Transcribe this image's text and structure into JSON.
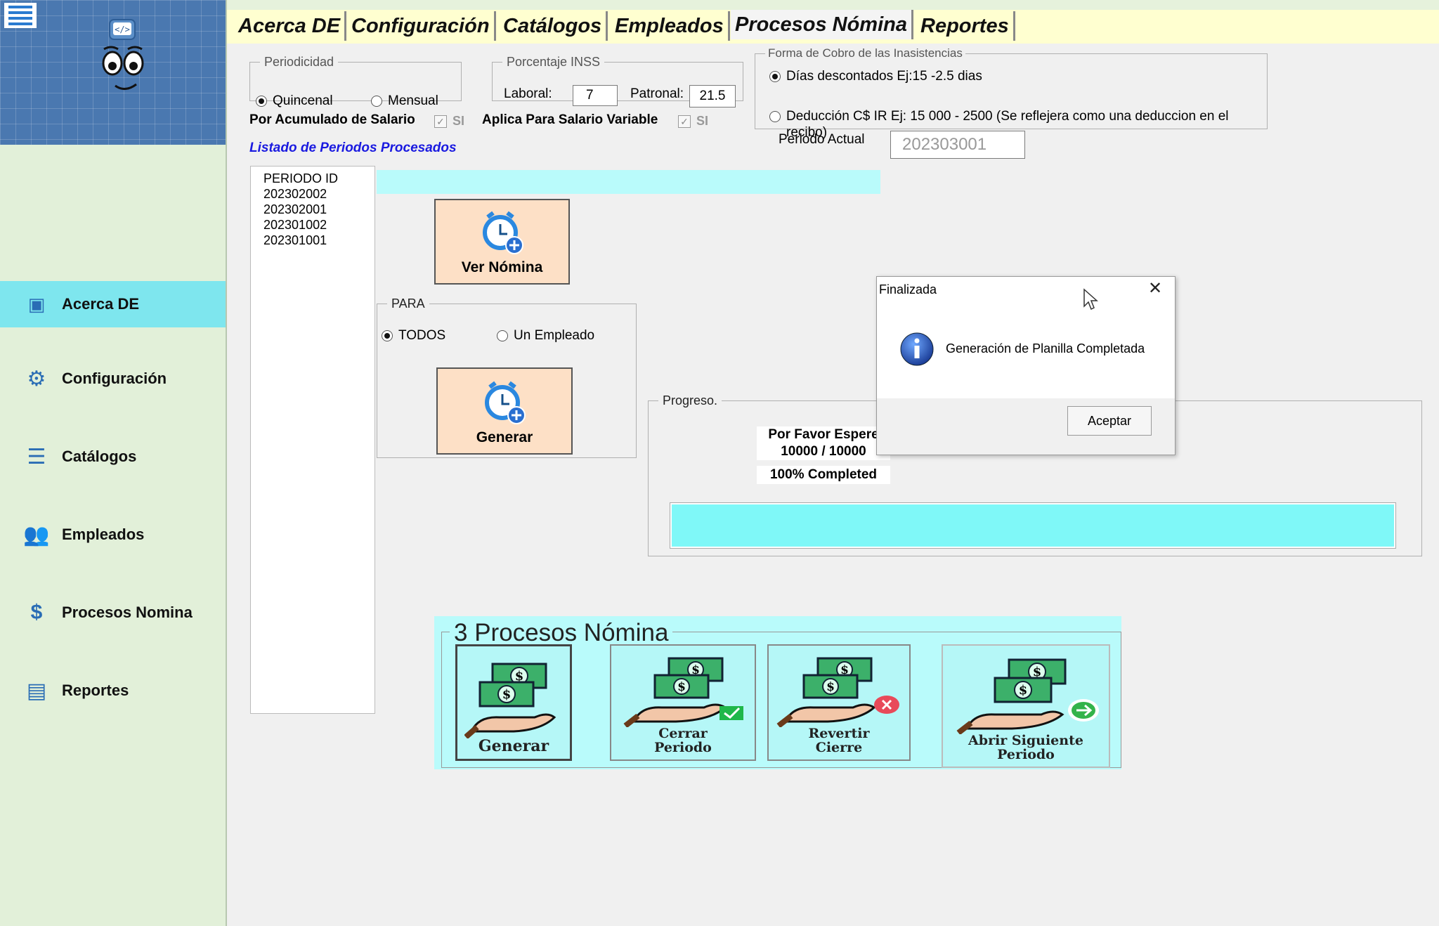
{
  "sidebar": {
    "items": [
      {
        "label": "Acerca DE",
        "icon": "about-icon",
        "active": true
      },
      {
        "label": "Configuración",
        "icon": "gear-icon",
        "active": false
      },
      {
        "label": "Catálogos",
        "icon": "catalog-icon",
        "active": false
      },
      {
        "label": "Empleados",
        "icon": "employees-icon",
        "active": false
      },
      {
        "label": "Procesos Nomina",
        "icon": "payroll-icon",
        "active": false
      },
      {
        "label": "Reportes",
        "icon": "reports-icon",
        "active": false
      }
    ]
  },
  "tabs": [
    {
      "label": "Acerca DE",
      "active": false
    },
    {
      "label": "Configuración",
      "active": false
    },
    {
      "label": "Catálogos",
      "active": false
    },
    {
      "label": "Empleados",
      "active": false
    },
    {
      "label": "Procesos Nómina",
      "active": true
    },
    {
      "label": "Reportes",
      "active": false
    }
  ],
  "periodicidad": {
    "legend": "Periodicidad",
    "options": [
      {
        "label": "Quincenal",
        "selected": true
      },
      {
        "label": "Mensual",
        "selected": false
      }
    ]
  },
  "inss": {
    "legend": "Porcentaje INSS",
    "laboral_label": "Laboral:",
    "laboral_value": "7",
    "patronal_label": "Patronal:",
    "patronal_value": "21.5"
  },
  "forma_cobro": {
    "legend": "Forma de Cobro de las Inasistencias",
    "option1": "Días descontados  Ej:15 -2.5 dias",
    "option1_selected": true,
    "option2": "Deducción C$ IR Ej: 15 000 - 2500 (Se reflejera como una deduccion en el recibo)",
    "option2_selected": false
  },
  "acumulado": {
    "label": "Por Acumulado de Salario",
    "check_label": "SI",
    "checked": true
  },
  "salario_variable": {
    "label": "Aplica Para Salario Variable",
    "check_label": "SI",
    "checked": true
  },
  "periodo_actual": {
    "label": "Periodo Actual",
    "value": "202303001"
  },
  "listado": {
    "title": "Listado de Periodos Procesados",
    "header": "PERIODO ID",
    "items": [
      "202302002",
      "202302001",
      "202301002",
      "202301001"
    ]
  },
  "ver_nomina": {
    "label": "Ver Nómina"
  },
  "para": {
    "legend": "PARA",
    "options": [
      {
        "label": "TODOS",
        "selected": true
      },
      {
        "label": "Un Empleado",
        "selected": false
      }
    ]
  },
  "generar": {
    "label": "Generar"
  },
  "progreso": {
    "legend": "Progreso.",
    "wait_text": "Por Favor Espere",
    "count_text": "10000 / 10000",
    "completed_text": "100% Completed",
    "progress": 1.0
  },
  "procesos": {
    "title": "3 Procesos Nómina",
    "buttons": [
      {
        "label": "Generar",
        "icon": "money-hand-icon"
      },
      {
        "label": "Cerrar Periodo",
        "icon": "money-hand-check-icon"
      },
      {
        "label": "Revertir Cierre",
        "icon": "money-hand-cancel-icon"
      },
      {
        "label": "Abrir Siguiente Periodo",
        "icon": "money-hand-next-icon"
      }
    ]
  },
  "dialog": {
    "title": "Finalizada",
    "message": "Generación de Planilla Completada",
    "ok_label": "Aceptar",
    "icon": "info-icon"
  },
  "colors": {
    "accent_cyan": "#7ee6ee",
    "sidebar_bg": "#e2f0d9",
    "button_peach": "#fde0c6",
    "progress_fill": "#7ff8f8",
    "list_title_blue": "#1a1ae0"
  }
}
